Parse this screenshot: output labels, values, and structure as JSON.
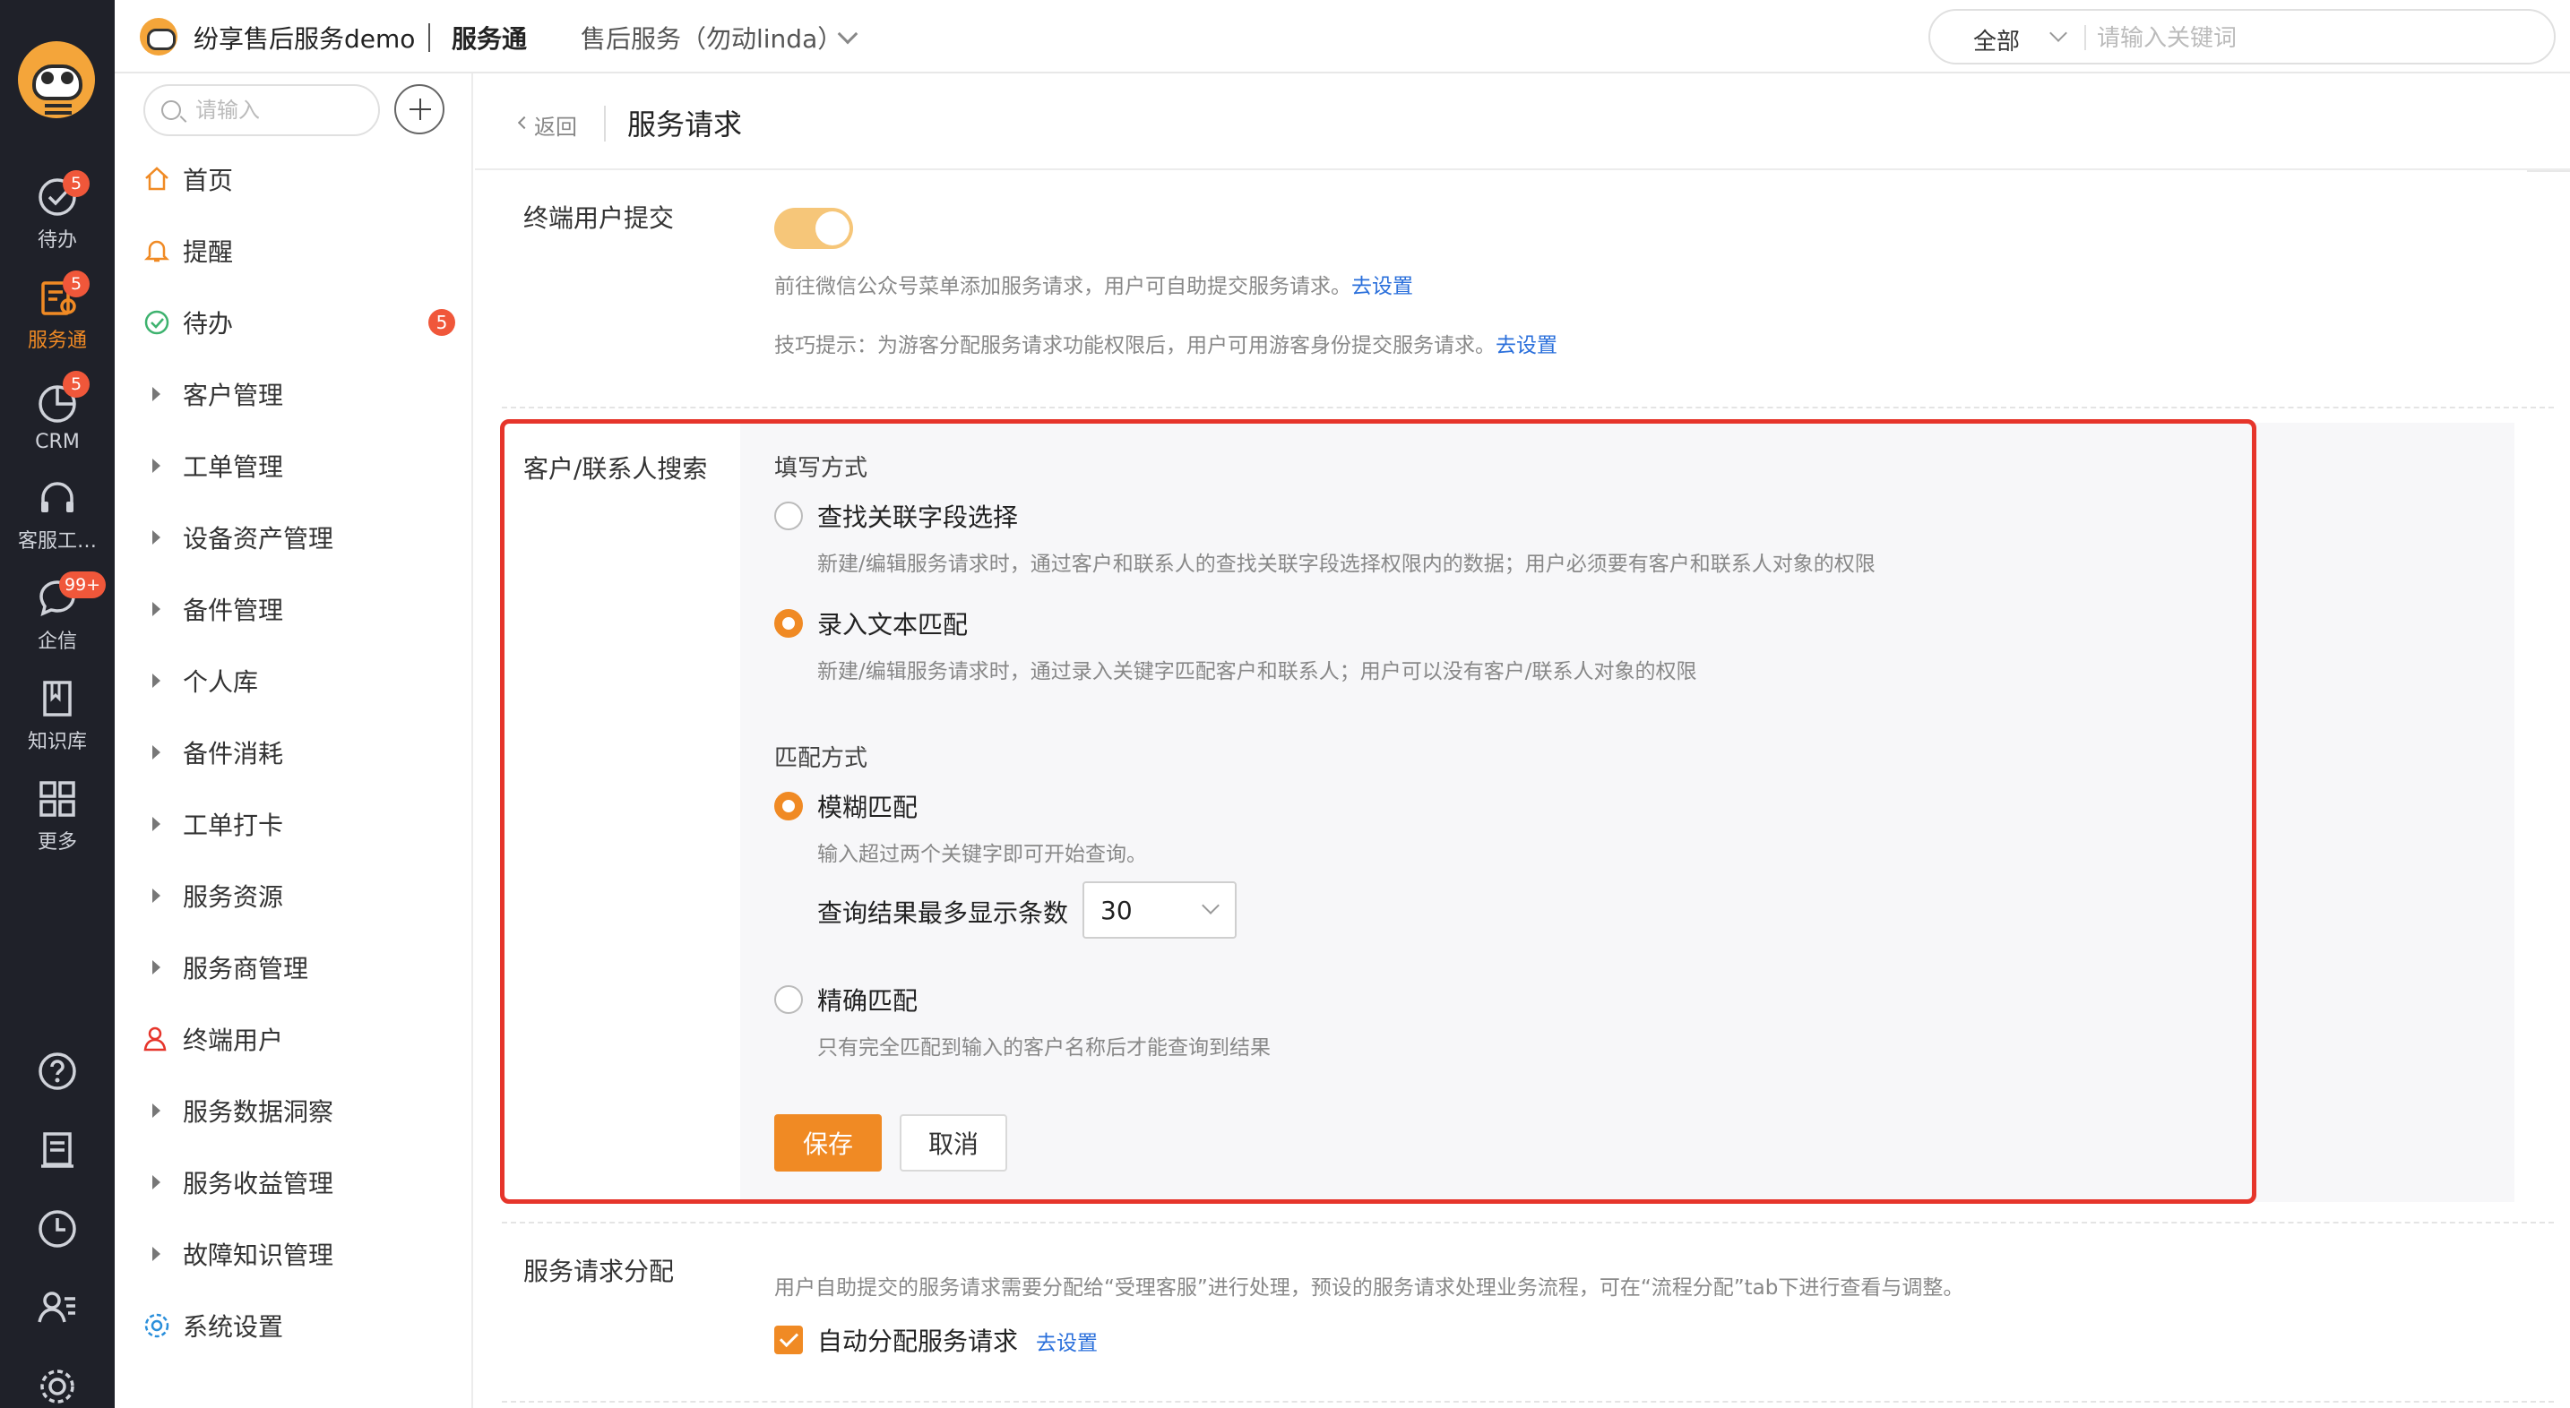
{
  "rail": {
    "items": [
      {
        "label": "待办",
        "badge": "5",
        "icon": "check-circle-icon"
      },
      {
        "label": "服务通",
        "badge": "5",
        "icon": "service-icon",
        "active": true
      },
      {
        "label": "CRM",
        "badge": "5",
        "icon": "pie-icon"
      },
      {
        "label": "客服工…",
        "badge": "",
        "icon": "headset-icon"
      },
      {
        "label": "企信",
        "badge": "99+",
        "icon": "chat-icon"
      },
      {
        "label": "知识库",
        "badge": "",
        "icon": "book-icon"
      },
      {
        "label": "更多",
        "badge": "",
        "icon": "grid-icon"
      }
    ],
    "bottom_icons": [
      "help-icon",
      "notes-icon",
      "clock-icon",
      "user-list-icon",
      "settings-icon"
    ]
  },
  "header": {
    "brand": "纷享售后服务demo",
    "product": "服务通",
    "workspace": "售后服务（勿动linda）",
    "search_scope": "全部",
    "search_placeholder": "请输入关键词"
  },
  "sidebar": {
    "search_placeholder": "请输入",
    "items": [
      {
        "label": "首页",
        "icon": "home-icon"
      },
      {
        "label": "提醒",
        "icon": "bell-icon"
      },
      {
        "label": "待办",
        "icon": "check-icon",
        "badge": "5"
      },
      {
        "label": "客户管理",
        "icon": "expand-arrow-icon"
      },
      {
        "label": "工单管理",
        "icon": "expand-arrow-icon"
      },
      {
        "label": "设备资产管理",
        "icon": "expand-arrow-icon"
      },
      {
        "label": "备件管理",
        "icon": "expand-arrow-icon"
      },
      {
        "label": "个人库",
        "icon": "expand-arrow-icon"
      },
      {
        "label": "备件消耗",
        "icon": "expand-arrow-icon"
      },
      {
        "label": "工单打卡",
        "icon": "expand-arrow-icon"
      },
      {
        "label": "服务资源",
        "icon": "expand-arrow-icon"
      },
      {
        "label": "服务商管理",
        "icon": "expand-arrow-icon"
      },
      {
        "label": "终端用户",
        "icon": "user-icon"
      },
      {
        "label": "服务数据洞察",
        "icon": "expand-arrow-icon"
      },
      {
        "label": "服务收益管理",
        "icon": "expand-arrow-icon"
      },
      {
        "label": "故障知识管理",
        "icon": "expand-arrow-icon"
      },
      {
        "label": "系统设置",
        "icon": "gear-icon"
      }
    ]
  },
  "page": {
    "back": "返回",
    "title": "服务请求",
    "end_user": {
      "label": "终端用户提交",
      "enabled": true,
      "desc1": "前往微信公众号菜单添加服务请求，用户可自助提交服务请求。",
      "desc1_link": "去设置",
      "desc2": "技巧提示：为游客分配服务请求功能权限后，用户可用游客身份提交服务请求。",
      "desc2_link": "去设置"
    },
    "search": {
      "label": "客户/联系人搜索",
      "fill_title": "填写方式",
      "fill_options": [
        {
          "label": "查找关联字段选择",
          "desc": "新建/编辑服务请求时，通过客户和联系人的查找关联字段选择权限内的数据；用户必须要有客户和联系人对象的权限",
          "checked": false
        },
        {
          "label": "录入文本匹配",
          "desc": "新建/编辑服务请求时，通过录入关键字匹配客户和联系人；用户可以没有客户/联系人对象的权限",
          "checked": true
        }
      ],
      "match_title": "匹配方式",
      "match_options": [
        {
          "label": "模糊匹配",
          "desc": "输入超过两个关键字即可开始查询。",
          "checked": true
        },
        {
          "label": "精确匹配",
          "desc": "只有完全匹配到输入的客户名称后才能查询到结果",
          "checked": false
        }
      ],
      "max_results_label": "查询结果最多显示条数",
      "max_results_value": "30",
      "save": "保存",
      "cancel": "取消"
    },
    "dispatch": {
      "label": "服务请求分配",
      "desc": "用户自助提交的服务请求需要分配给“受理客服”进行处理，预设的服务请求处理业务流程，可在“流程分配”tab下进行查看与调整。",
      "checkbox_label": "自动分配服务请求",
      "checked": true,
      "link": "去设置"
    }
  },
  "colors": {
    "accent": "#f08a24",
    "highlight": "#e6352b",
    "link": "#2a6fdb",
    "rail_bg": "#1f2129"
  }
}
